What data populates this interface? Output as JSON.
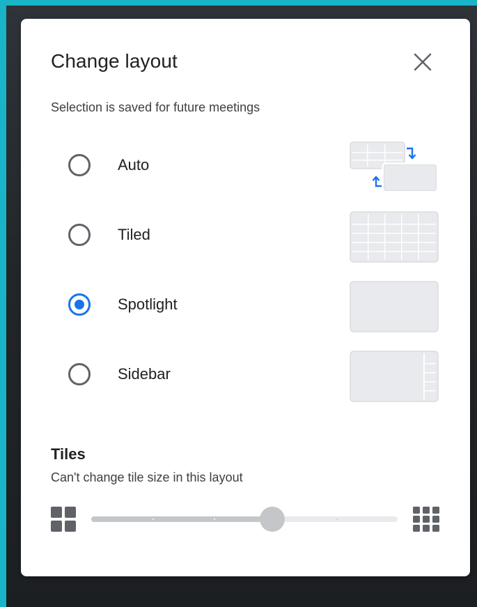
{
  "dialog": {
    "title": "Change layout",
    "subtitle": "Selection is saved for future meetings",
    "close_icon": "close-icon"
  },
  "layouts": [
    {
      "label": "Auto",
      "selected": false,
      "thumbnail": "auto-layout-icon"
    },
    {
      "label": "Tiled",
      "selected": false,
      "thumbnail": "tiled-layout-icon"
    },
    {
      "label": "Spotlight",
      "selected": true,
      "thumbnail": "spotlight-layout-icon"
    },
    {
      "label": "Sidebar",
      "selected": false,
      "thumbnail": "sidebar-layout-icon"
    }
  ],
  "tiles": {
    "title": "Tiles",
    "subtitle": "Can't change tile size in this layout",
    "slider_value_fraction": 0.59,
    "disabled": true,
    "min_icon": "fewer-tiles-icon",
    "max_icon": "more-tiles-icon"
  },
  "colors": {
    "accent": "#1a73e8",
    "text": "#202124",
    "disabled": "#c4c7c9",
    "frame": "#19b4c8"
  }
}
